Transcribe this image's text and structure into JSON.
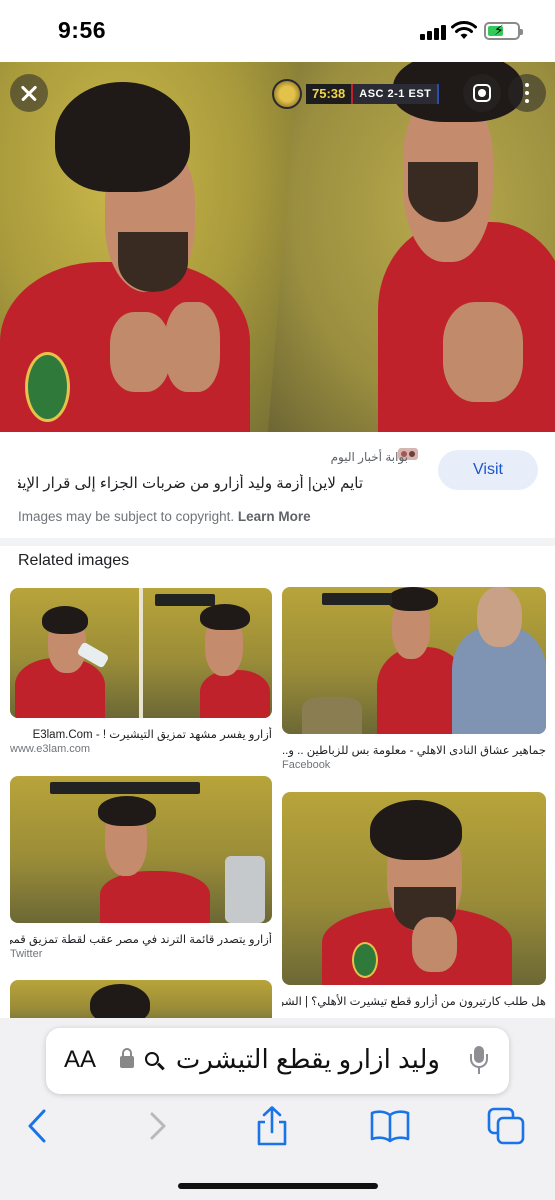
{
  "status_bar": {
    "time": "9:56",
    "signal_icon": "cellular-signal-icon",
    "wifi_icon": "wifi-icon",
    "battery_icon": "battery-charging-icon",
    "battery_level_percent": 55,
    "battery_color": "#34c759"
  },
  "viewer": {
    "close_icon": "close-icon",
    "lens_icon": "google-lens-icon",
    "more_icon": "more-vertical-icon",
    "scoreboard": {
      "match_time": "75:38",
      "score": "ASC 2-1 EST"
    }
  },
  "result": {
    "source_name": "بوابة أخبار اليوم",
    "title": "تايم لاين| أزمة وليد أزارو من ضربات الجزاء إلى قرار الإيقاف ...",
    "visit_label": "Visit",
    "copyright_text": "Images may be subject to copyright.",
    "learn_more_label": "Learn More"
  },
  "related": {
    "heading": "Related images",
    "items": [
      {
        "caption": "أزارو يفسر مشهد تمزيق التيشيرت ! - E3lam.Com",
        "source": "www.e3lam.com"
      },
      {
        "caption": "جماهير عشاق النادى الاهلي - معلومة بس للزباطين .. و...",
        "source": "Facebook"
      },
      {
        "caption": "أزارو يتصدر قائمة الترند في مصر عقب لقطة تمزيق قمي...",
        "source": "Twitter"
      },
      {
        "caption": "هل طلب كارتيرون من أزارو قطع تيشيرت الأهلي؟ | الشر...",
        "source": ""
      }
    ]
  },
  "browser": {
    "text_size_label": "AA",
    "lock_icon": "lock-icon",
    "search_icon": "search-icon",
    "query": "وليد ازارو يقطع التيشرت",
    "mic_icon": "microphone-icon",
    "toolbar": {
      "back_icon": "back-chevron-icon",
      "forward_icon": "forward-chevron-icon",
      "share_icon": "share-icon",
      "bookmarks_icon": "bookmarks-book-icon",
      "tabs_icon": "tabs-icon"
    },
    "accent_color": "#1a73e8"
  }
}
